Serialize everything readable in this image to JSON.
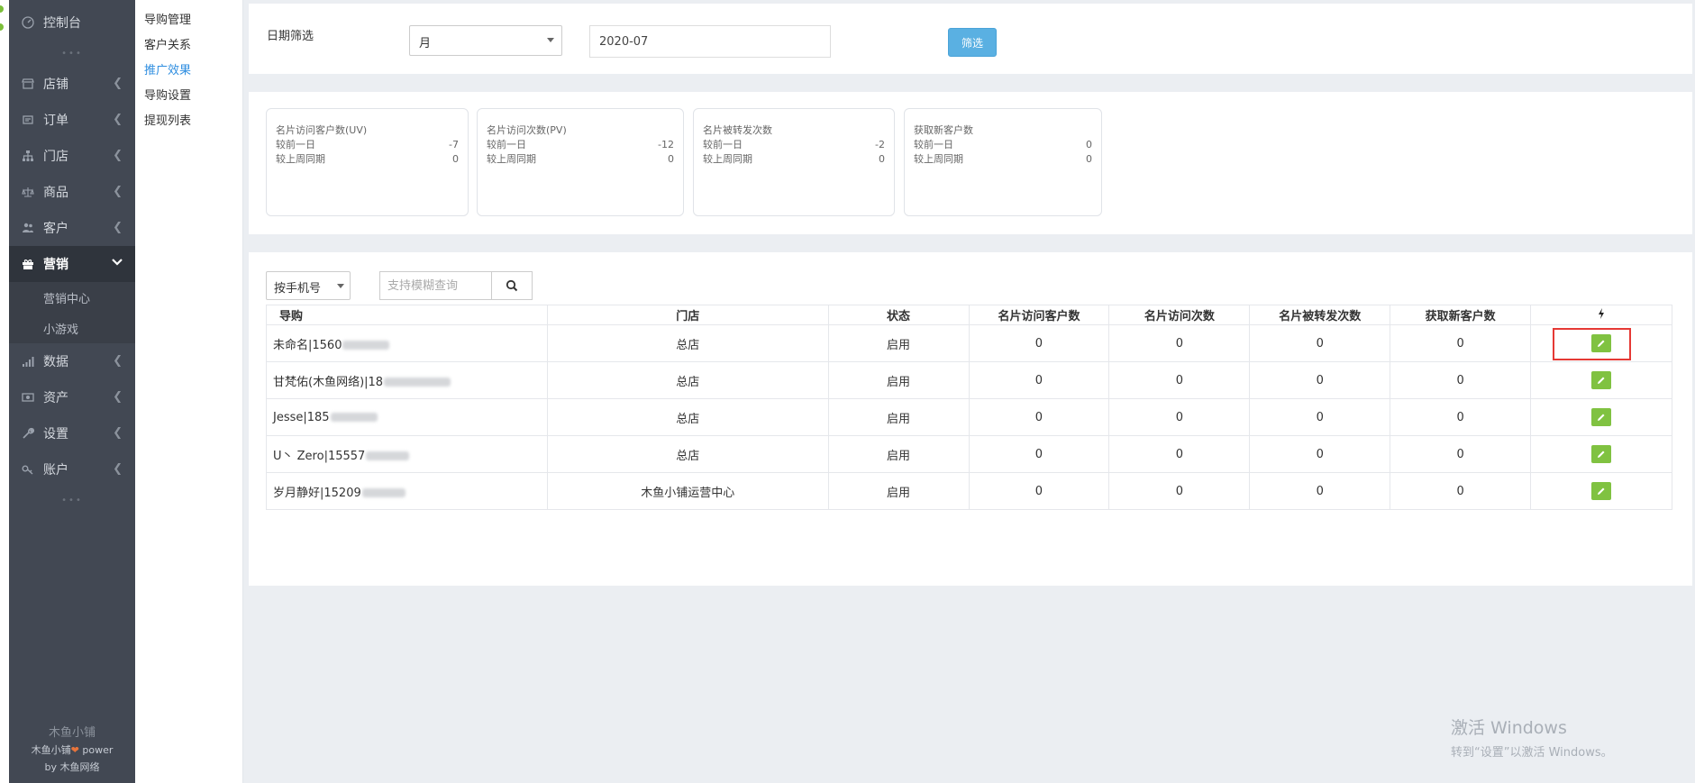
{
  "sidebar": {
    "items": [
      {
        "label": "控制台",
        "icon": "dashboard-icon",
        "chevron": false
      },
      {
        "label": "店铺",
        "icon": "shop-icon",
        "chevron": true
      },
      {
        "label": "订单",
        "icon": "order-icon",
        "chevron": true
      },
      {
        "label": "门店",
        "icon": "store-icon",
        "chevron": true
      },
      {
        "label": "商品",
        "icon": "goods-icon",
        "chevron": true
      },
      {
        "label": "客户",
        "icon": "customer-icon",
        "chevron": true
      },
      {
        "label": "营销",
        "icon": "gift-icon",
        "chevron": true,
        "active": true
      },
      {
        "label": "数据",
        "icon": "chart-icon",
        "chevron": true
      },
      {
        "label": "资产",
        "icon": "asset-icon",
        "chevron": true
      },
      {
        "label": "设置",
        "icon": "wrench-icon",
        "chevron": true
      },
      {
        "label": "账户",
        "icon": "key-icon",
        "chevron": true
      }
    ],
    "sub_items": [
      "营销中心",
      "小游戏"
    ],
    "footer": {
      "brand": "木鱼小铺",
      "line2_prefix": "木鱼小铺",
      "line2_suffix": "power",
      "line3": "by 木鱼网络"
    }
  },
  "subsidebar": {
    "items": [
      {
        "label": "导购管理",
        "active": false
      },
      {
        "label": "客户关系",
        "active": false
      },
      {
        "label": "推广效果",
        "active": true
      },
      {
        "label": "导购设置",
        "active": false
      },
      {
        "label": "提现列表",
        "active": false
      }
    ]
  },
  "filter": {
    "label": "日期筛选",
    "period": "月",
    "date_value": "2020-07",
    "button": "筛选"
  },
  "stats": [
    {
      "title": "名片访问客户数(UV)",
      "row1_label": "较前一日",
      "row1_value": "-7",
      "row2_label": "较上周同期",
      "row2_value": "0"
    },
    {
      "title": "名片访问次数(PV)",
      "row1_label": "较前一日",
      "row1_value": "-12",
      "row2_label": "较上周同期",
      "row2_value": "0"
    },
    {
      "title": "名片被转发次数",
      "row1_label": "较前一日",
      "row1_value": "-2",
      "row2_label": "较上周同期",
      "row2_value": "0"
    },
    {
      "title": "获取新客户数",
      "row1_label": "较前一日",
      "row1_value": "0",
      "row2_label": "较上周同期",
      "row2_value": "0"
    }
  ],
  "search": {
    "field": "按手机号",
    "placeholder": "支持模糊查询"
  },
  "table": {
    "headers": [
      "导购",
      "门店",
      "状态",
      "名片访问客户数",
      "名片访问次数",
      "名片被转发次数",
      "获取新客户数"
    ],
    "action_header_icon": "bolt-icon",
    "rows": [
      {
        "guide": "未命名|1560",
        "store": "总店",
        "status": "启用",
        "uv": "0",
        "pv": "0",
        "shares": "0",
        "new_customers": "0"
      },
      {
        "guide": "甘梵佑(木鱼网络)|18",
        "store": "总店",
        "status": "启用",
        "uv": "0",
        "pv": "0",
        "shares": "0",
        "new_customers": "0"
      },
      {
        "guide": "Jesse|185",
        "store": "总店",
        "status": "启用",
        "uv": "0",
        "pv": "0",
        "shares": "0",
        "new_customers": "0"
      },
      {
        "guide": "U丶 Zero|15557",
        "store": "总店",
        "status": "启用",
        "uv": "0",
        "pv": "0",
        "shares": "0",
        "new_customers": "0"
      },
      {
        "guide": "岁月静好|15209",
        "store": "木鱼小铺运营中心",
        "status": "启用",
        "uv": "0",
        "pv": "0",
        "shares": "0",
        "new_customers": "0"
      }
    ]
  },
  "watermark": {
    "line1": "激活 Windows",
    "line2": "转到“设置”以激活 Windows。"
  },
  "colors": {
    "sidebar_bg": "#424853",
    "active_link": "#2f8ee0",
    "filter_button": "#5ab0e2",
    "edit_button": "#80c241",
    "highlight": "#e53935"
  }
}
